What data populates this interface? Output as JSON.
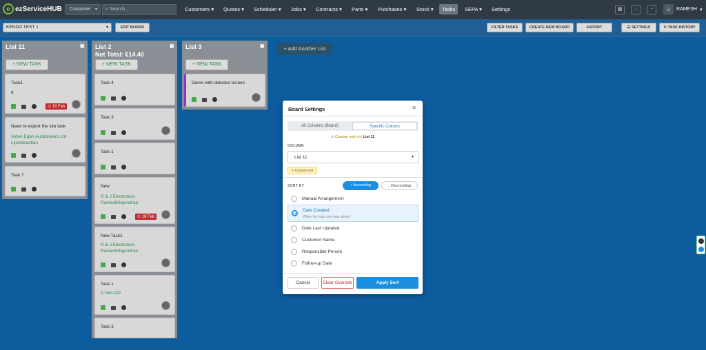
{
  "app": {
    "logo_letter": "e",
    "logo_text": "ezServiceHUB"
  },
  "topnav": {
    "customer_select": "Customer",
    "search_placeholder": "Search...",
    "items": [
      "Customers ▾",
      "Quotes ▾",
      "Scheduler ▾",
      "Jobs ▾",
      "Contracts ▾",
      "Parts ▾",
      "Purchases ▾",
      "Stock ▾",
      "Tasks",
      "SEPA ▾",
      "Settings"
    ],
    "user": "RAMESH"
  },
  "boardbar": {
    "board_name": "KENDO TEST 1",
    "edit_board": "EDIT BOARD",
    "filter_tasks": "FILTER TASKS",
    "create_new_board": "CREATE NEW BOARD",
    "export": "EXPORT",
    "settings": "☰ SETTINGS",
    "task_history": "↻ TASK HISTORY"
  },
  "lists": [
    {
      "title": "List 11",
      "new_task": "+ NEW TASK",
      "cards": [
        {
          "title": "Task1",
          "sub": "It",
          "due": "19 Feb"
        },
        {
          "title": "Need to export the site task",
          "g1": "Alden Egan Auctioneers Ltd",
          "g2": "LijoSebastian"
        },
        {
          "title": "Task 7"
        }
      ]
    },
    {
      "title": "List 2",
      "net": "Net Total: €14.40",
      "new_task": "+ NEW TASK",
      "cards": [
        {
          "title": "Task 4"
        },
        {
          "title": "Task 3"
        },
        {
          "title": "Task 1"
        },
        {
          "title": "New",
          "g1": "R & J Electronics",
          "g2": "RameshRajendran",
          "due": "18 Feb"
        },
        {
          "title": "New Task1",
          "g1": "R & J Electronics",
          "g2": "RameshRajendran"
        },
        {
          "title": "Task 1",
          "g1": "A Non DD"
        },
        {
          "title": "Task 3"
        }
      ]
    },
    {
      "title": "List 3",
      "new_task": "+ NEW TASK",
      "cards": [
        {
          "title": "Demo with detector testers"
        }
      ]
    }
  ],
  "add_list": "+ Add Another List",
  "modal": {
    "title": "Board Settings",
    "close": "✕",
    "tab_all": "All Columns (Board)",
    "tab_specific": "Specific Column",
    "note_prefix": "⚠ Custom sort on:",
    "note_list": "List 11",
    "column_label": "COLUMN",
    "column_value": "List 11",
    "custom_badge": "✎ Custom sort",
    "sort_by_label": "SORT BY",
    "ascending": "↑ Ascending",
    "descending": "↓ Descending",
    "options": [
      {
        "label": "Manual Arrangement"
      },
      {
        "label": "Date Created",
        "sub": "When the task card was added"
      },
      {
        "label": "Date Last Updated"
      },
      {
        "label": "Customer Name"
      },
      {
        "label": "Responsible Person"
      },
      {
        "label": "Follow-up Date"
      }
    ],
    "cancel": "Cancel",
    "clear_override": "Clear Override",
    "apply_sort": "Apply Sort"
  },
  "colors": {
    "accent": "#1a8fe0",
    "board_bg": "#0d5d9e",
    "topnav_bg": "#2f3a45",
    "due_red": "#c0282d"
  }
}
